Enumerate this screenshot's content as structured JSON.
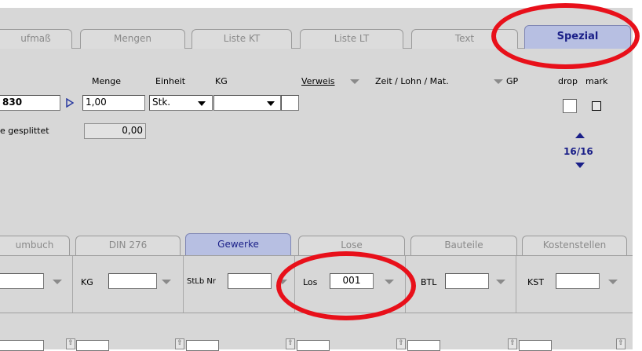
{
  "top_tabs": [
    {
      "label": "ufmaß"
    },
    {
      "label": "Mengen"
    },
    {
      "label": "Liste KT"
    },
    {
      "label": "Liste LT"
    },
    {
      "label": "Text"
    },
    {
      "label": "Spezial",
      "active": true
    }
  ],
  "headers": {
    "menge": "Menge",
    "einheit": "Einheit",
    "kg": "KG",
    "verweis": "Verweis",
    "zeit": "Zeit / Lohn / Mat.",
    "gp": "GP",
    "drop": "drop",
    "mark": "mark"
  },
  "row": {
    "pos": "830",
    "menge": "1,00",
    "einheit": "Stk.",
    "kg": ""
  },
  "split": {
    "label": "e gesplittet",
    "value": "0,00"
  },
  "pager": {
    "text": "16/16"
  },
  "bottom_tabs": [
    {
      "label": "umbuch"
    },
    {
      "label": "DIN 276"
    },
    {
      "label": "Gewerke",
      "active": true
    },
    {
      "label": "Lose"
    },
    {
      "label": "Bauteile"
    },
    {
      "label": "Kostenstellen"
    }
  ],
  "filters": {
    "kg_label": "KG",
    "stlb_label": "StLb Nr",
    "los_label": "Los",
    "los_value": "001",
    "btl_label": "BTL",
    "kst_label": "KST"
  },
  "colors": {
    "highlight_ring": "#e8101a",
    "active_tab": "#b7bfe2",
    "active_tab_text": "#1a1f88",
    "pager_arrow": "#1a1f88"
  }
}
